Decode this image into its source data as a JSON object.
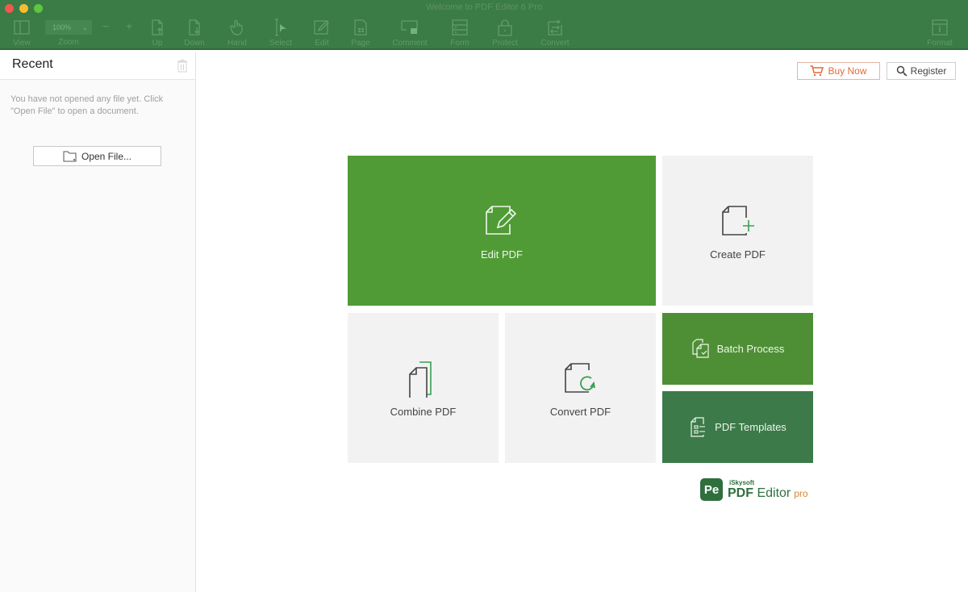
{
  "window": {
    "title": "Welcome to PDF Editor 6 Pro"
  },
  "toolbar": {
    "zoom_value": "100%",
    "zoom_label": "Zoom",
    "zoom_out": "−",
    "zoom_in": "+",
    "tools": [
      {
        "label": "View",
        "icon": "view-icon"
      },
      {
        "label": "Up",
        "icon": "page-up-icon"
      },
      {
        "label": "Down",
        "icon": "page-down-icon"
      },
      {
        "label": "Hand",
        "icon": "hand-icon"
      },
      {
        "label": "Select",
        "icon": "select-icon"
      },
      {
        "label": "Edit",
        "icon": "edit-icon"
      },
      {
        "label": "Page",
        "icon": "page-icon"
      },
      {
        "label": "Comment",
        "icon": "comment-icon"
      },
      {
        "label": "Form",
        "icon": "form-icon"
      },
      {
        "label": "Protect",
        "icon": "lock-icon"
      },
      {
        "label": "Convert",
        "icon": "convert-icon"
      },
      {
        "label": "Format",
        "icon": "format-icon"
      }
    ]
  },
  "sidebar": {
    "title": "Recent",
    "empty_message": "You have not opened any file yet. Click \"Open File\" to open a document.",
    "open_button": "Open File..."
  },
  "header_buttons": {
    "buy_now": "Buy Now",
    "register": "Register"
  },
  "tiles": {
    "edit": "Edit PDF",
    "create": "Create PDF",
    "combine": "Combine PDF",
    "convert": "Convert PDF",
    "batch": "Batch Process",
    "templates": "PDF Templates"
  },
  "logo": {
    "mark": "Pe",
    "brand": "iSkysoft",
    "name_bold": "PDF",
    "name_rest": " Editor",
    "edition": "pro"
  },
  "colors": {
    "toolbar": "#3b7b46",
    "edit_tile": "#509b36",
    "batch_tile": "#4e8f35",
    "templates_tile": "#3c7a4a",
    "buy_accent": "#e06b3a",
    "icon_green": "#3aa052"
  }
}
